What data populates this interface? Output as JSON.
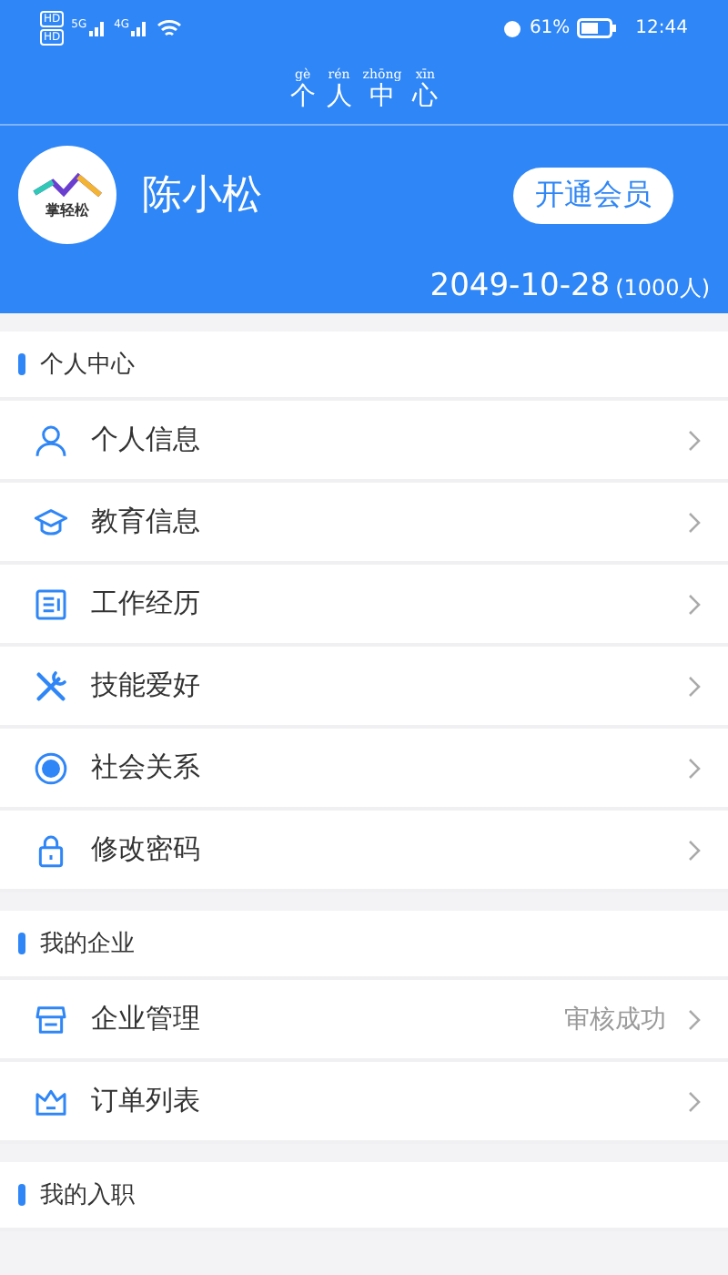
{
  "status_bar": {
    "sim_badges": [
      "HD",
      "HD"
    ],
    "networks": [
      "5G",
      "4G"
    ],
    "battery": "61%",
    "time": "12:44"
  },
  "title": [
    {
      "hanzi": "个",
      "pinyin": "gè"
    },
    {
      "hanzi": "人",
      "pinyin": "rén"
    },
    {
      "hanzi": "中",
      "pinyin": "zhōng"
    },
    {
      "hanzi": "心",
      "pinyin": "xīn"
    }
  ],
  "profile": {
    "logo_text": "掌轻松",
    "name": "陈小松",
    "member_button": "开通会员",
    "expiry": "2049-10-28",
    "count": "(1000人)"
  },
  "sections": [
    {
      "header": "个人中心",
      "items": [
        {
          "kind": "person",
          "label": "个人信息"
        },
        {
          "kind": "education",
          "label": "教育信息"
        },
        {
          "kind": "work",
          "label": "工作经历"
        },
        {
          "kind": "skills",
          "label": "技能爱好"
        },
        {
          "kind": "relations",
          "label": "社会关系"
        },
        {
          "kind": "password",
          "label": "修改密码"
        }
      ]
    },
    {
      "header": "我的企业",
      "items": [
        {
          "kind": "company",
          "label": "企业管理",
          "status": "审核成功"
        },
        {
          "kind": "orders",
          "label": "订单列表"
        }
      ]
    },
    {
      "header": "我的入职"
    }
  ]
}
